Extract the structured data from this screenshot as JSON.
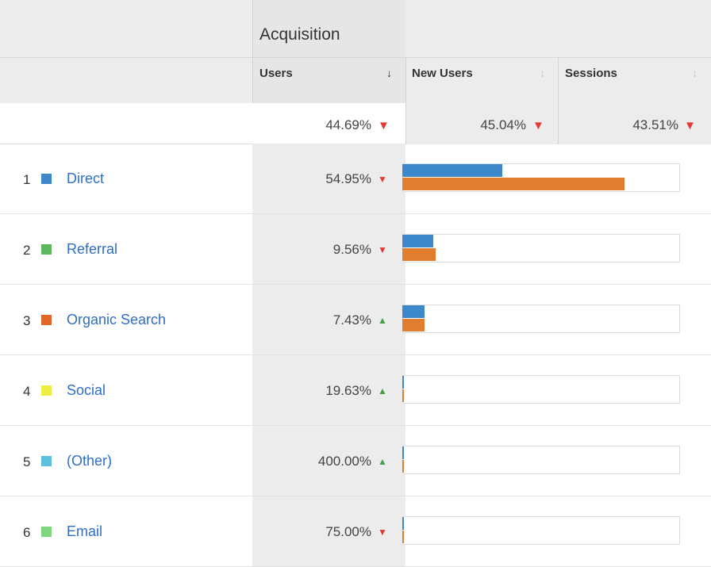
{
  "header": {
    "group_title": "Acquisition",
    "columns": [
      {
        "label": "Users",
        "sort_glyph": "↓",
        "active": true
      },
      {
        "label": "New Users",
        "sort_glyph": "↓",
        "active": false
      },
      {
        "label": "Sessions",
        "sort_glyph": "↓",
        "active": false
      }
    ]
  },
  "totals": {
    "users": "44.69%",
    "new_users": "45.04%",
    "sessions": "43.51%",
    "arrow_users": "down",
    "arrow_new_users": "down",
    "arrow_sessions": "down"
  },
  "colors": {
    "bar_primary": "#3d88c8",
    "bar_secondary": "#e07d2e",
    "down": "#e53935",
    "up": "#43a047",
    "link": "#2f6ec6"
  },
  "rows": [
    {
      "index": "1",
      "channel": "Direct",
      "swatch": "#3d88c8",
      "users_change": "54.95%",
      "trend": "down",
      "bar_primary_fraction": 0.36,
      "bar_secondary_fraction": 0.8
    },
    {
      "index": "2",
      "channel": "Referral",
      "swatch": "#5cb85c",
      "users_change": "9.56%",
      "trend": "down",
      "bar_primary_fraction": 0.11,
      "bar_secondary_fraction": 0.12
    },
    {
      "index": "3",
      "channel": "Organic Search",
      "swatch": "#e0662a",
      "users_change": "7.43%",
      "trend": "up",
      "bar_primary_fraction": 0.08,
      "bar_secondary_fraction": 0.08
    },
    {
      "index": "4",
      "channel": "Social",
      "swatch": "#eded45",
      "users_change": "19.63%",
      "trend": "up",
      "bar_primary_fraction": 0.006,
      "bar_secondary_fraction": 0.006
    },
    {
      "index": "5",
      "channel": "(Other)",
      "swatch": "#5bc0de",
      "users_change": "400.00%",
      "trend": "up",
      "bar_primary_fraction": 0.006,
      "bar_secondary_fraction": 0.006
    },
    {
      "index": "6",
      "channel": "Email",
      "swatch": "#7ed67e",
      "users_change": "75.00%",
      "trend": "down",
      "bar_primary_fraction": 0.006,
      "bar_secondary_fraction": 0.006
    }
  ]
}
